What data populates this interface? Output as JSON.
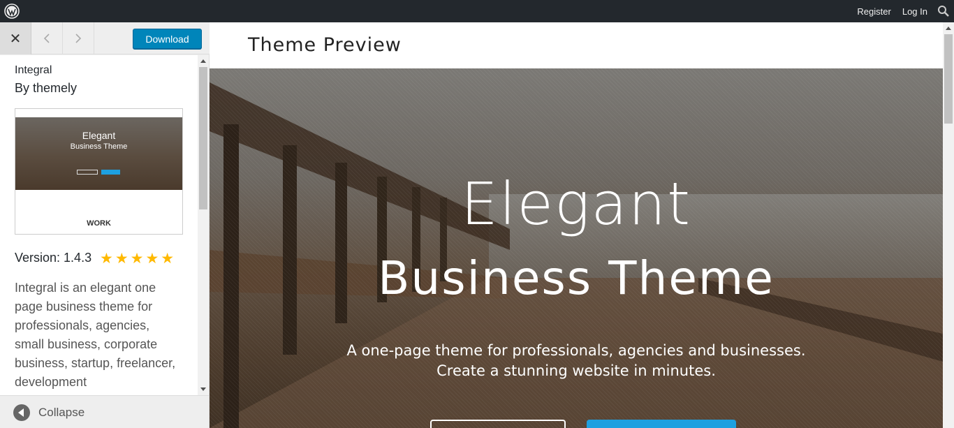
{
  "adminbar": {
    "register": "Register",
    "login": "Log In"
  },
  "sidebar": {
    "close_label": "✕",
    "download_label": "Download",
    "theme_name": "Integral",
    "theme_author": "By themely",
    "thumbnail": {
      "hero_line1": "Elegant",
      "hero_line2": "Business Theme",
      "section_label": "WORK"
    },
    "version": "Version: 1.4.3",
    "rating_stars": "★★★★★",
    "rating": 5,
    "description": "Integral is an elegant one page business theme for professionals, agencies, small business, corporate business, startup, freelancer, development",
    "collapse_label": "Collapse"
  },
  "preview": {
    "title": "Theme Preview",
    "hero_title1": "Elegant",
    "hero_title2": "Business Theme",
    "hero_sub1": "A one-page theme for professionals, agencies and businesses.",
    "hero_sub2": "Create a stunning website in minutes."
  },
  "colors": {
    "adminbar_bg": "#23282d",
    "button_primary": "#0085ba",
    "star": "#ffb900",
    "hero_accent": "#1ea0e0"
  }
}
